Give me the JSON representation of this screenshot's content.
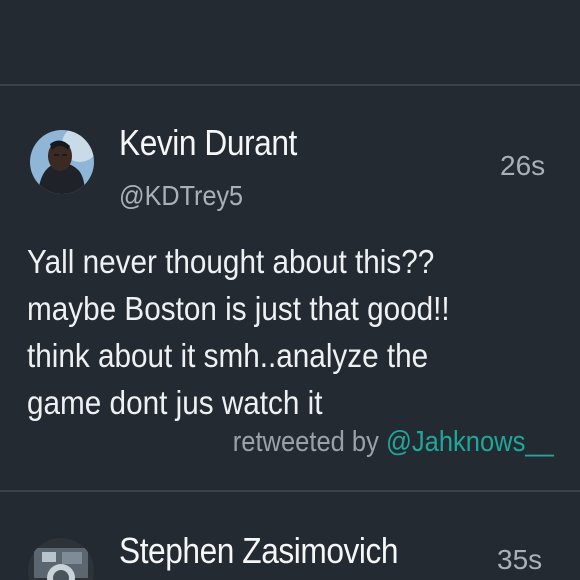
{
  "tweets": [
    {
      "name": "Kevin Durant",
      "handle": "@KDTrey5",
      "time": "26s",
      "text_lines": [
        "Yall never thought about this??",
        "maybe Boston is just that good!!",
        "think about it smh..analyze the",
        "game dont jus watch it"
      ],
      "retweet_prefix": "retweeted by ",
      "retweet_user": "@Jahknows__"
    },
    {
      "name": "Stephen Zasimovich",
      "time": "35s"
    }
  ],
  "colors": {
    "background": "#242a31",
    "divider": "#3a4149",
    "secondary_text": "#a9b0b7",
    "link": "#1ea79a"
  }
}
